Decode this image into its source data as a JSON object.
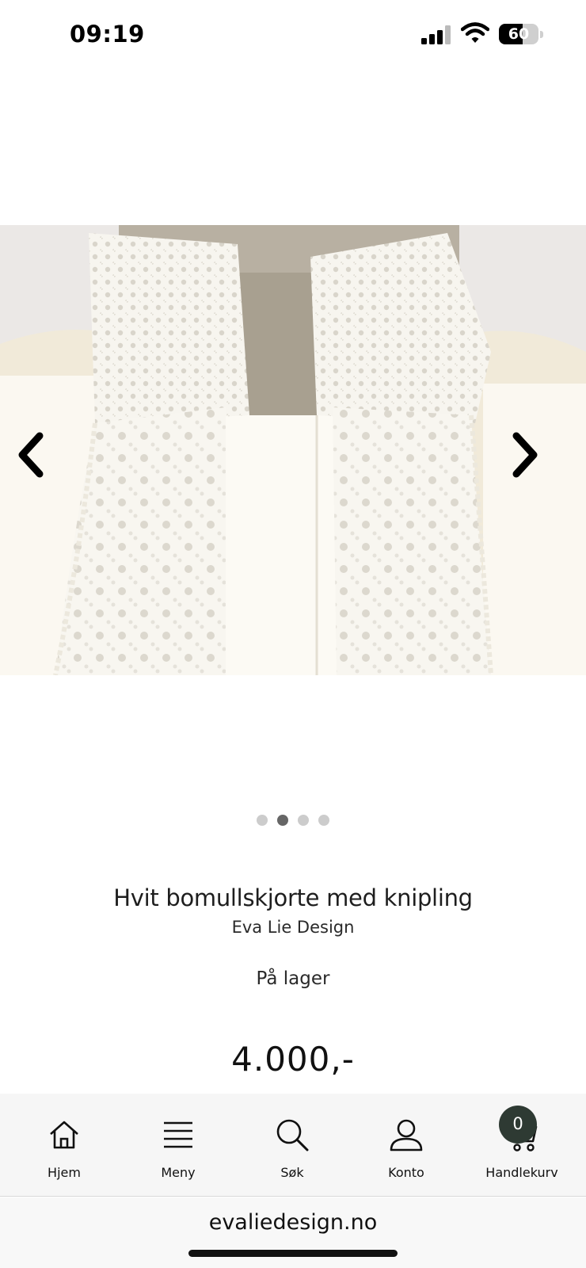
{
  "status_bar": {
    "time": "09:19",
    "battery": "60",
    "battery_level": 0.6
  },
  "carousel": {
    "total_images": 4,
    "active_index": 1
  },
  "product": {
    "title": "Hvit bomullskjorte med knipling",
    "brand": "Eva Lie Design",
    "stock": "På lager",
    "price": "4.000,-"
  },
  "bottom_nav": {
    "items": [
      {
        "label": "Hjem",
        "icon": "home-icon"
      },
      {
        "label": "Meny",
        "icon": "menu-icon"
      },
      {
        "label": "Søk",
        "icon": "search-icon"
      },
      {
        "label": "Konto",
        "icon": "account-icon"
      },
      {
        "label": "Handlekurv",
        "icon": "cart-icon"
      }
    ],
    "cart_count": "0"
  },
  "browser": {
    "url": "evaliedesign.no"
  },
  "colors": {
    "badge": "#2e3a33",
    "nav_bg": "#f6f6f6",
    "dot_active": "#666666",
    "dot_inactive": "#cccccc"
  }
}
